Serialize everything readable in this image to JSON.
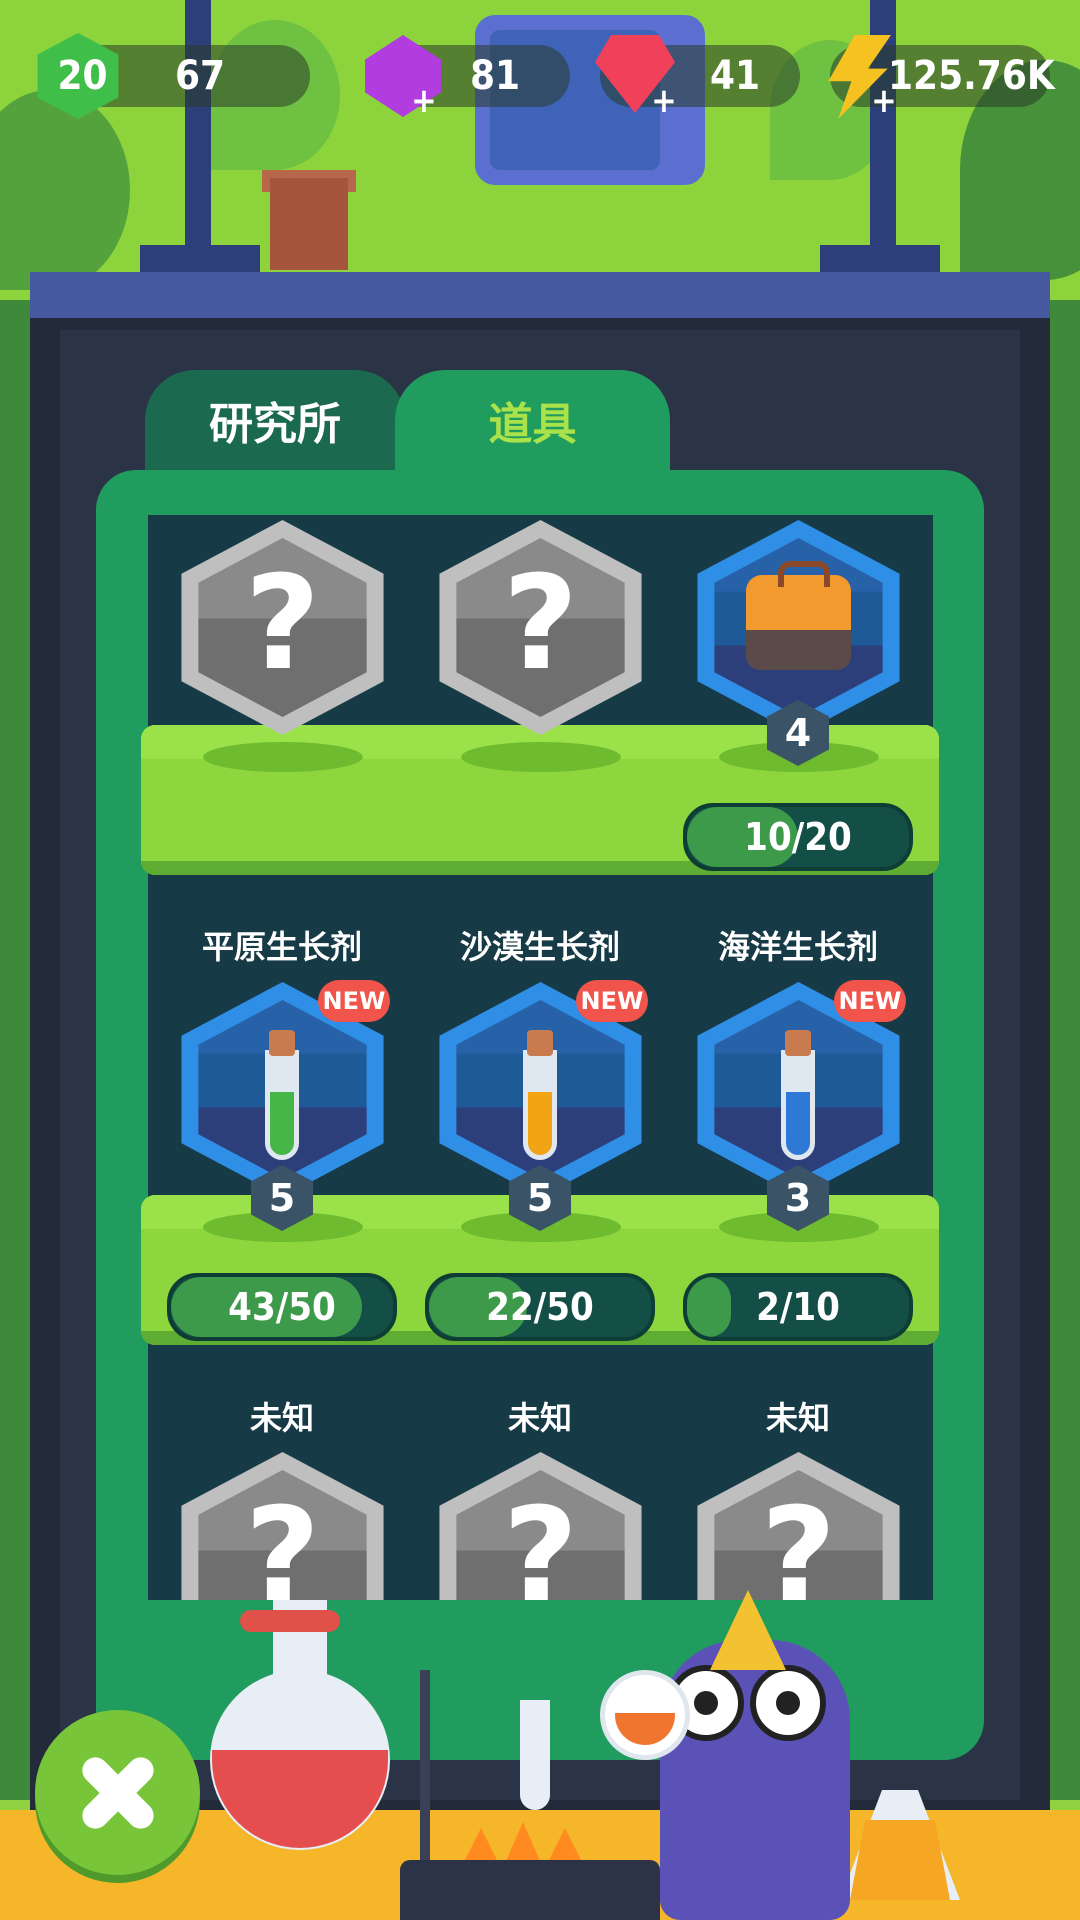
{
  "hud": {
    "level": "20",
    "xp": "67",
    "purple_gems": "81",
    "red_gems": "41",
    "energy": "125.76K"
  },
  "tabs": [
    {
      "label": "研究所",
      "active": false
    },
    {
      "label": "道具",
      "active": true
    }
  ],
  "shelves": [
    {
      "items": [
        {
          "label": "",
          "locked": true,
          "icon": "question-mark-icon"
        },
        {
          "label": "",
          "locked": true,
          "icon": "question-mark-icon"
        },
        {
          "label": "",
          "locked": false,
          "icon": "backpack-icon",
          "count": "4",
          "progress_text": "10/20",
          "progress": 0.5
        }
      ]
    },
    {
      "items": [
        {
          "label": "平原生长剂",
          "badge": "NEW",
          "icon": "green-potion-tube-icon",
          "count": "5",
          "progress_text": "43/50",
          "progress": 0.86
        },
        {
          "label": "沙漠生长剂",
          "badge": "NEW",
          "icon": "orange-potion-tube-icon",
          "count": "5",
          "progress_text": "22/50",
          "progress": 0.44
        },
        {
          "label": "海洋生长剂",
          "badge": "NEW",
          "icon": "blue-potion-tube-icon",
          "count": "3",
          "progress_text": "2/10",
          "progress": 0.2
        }
      ]
    },
    {
      "items": [
        {
          "label": "未知",
          "locked": true,
          "icon": "question-mark-icon"
        },
        {
          "label": "未知",
          "locked": true,
          "icon": "question-mark-icon"
        },
        {
          "label": "未知",
          "locked": true,
          "icon": "question-mark-icon"
        }
      ]
    }
  ],
  "qmark": "?",
  "plus": "+",
  "colors": {
    "panel": "#1f9c5e",
    "shelf": "#8dd63d",
    "new_badge": "#f0544a",
    "green_liquid": "#46b648",
    "orange_liquid": "#f2a414",
    "blue_liquid": "#2f79d6"
  }
}
